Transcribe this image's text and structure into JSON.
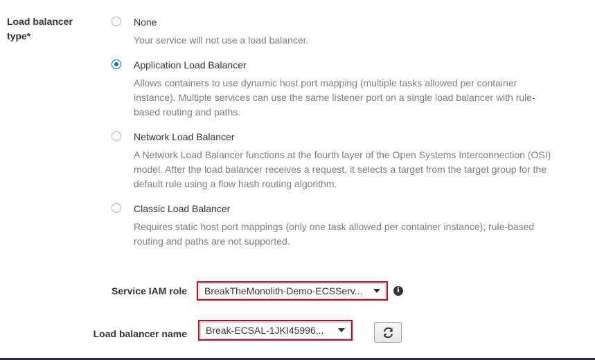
{
  "load_balancer_type": {
    "label": "Load balancer type*",
    "options": [
      {
        "title": "None",
        "description": "Your service will not use a load balancer.",
        "selected": false
      },
      {
        "title": "Application Load Balancer",
        "description": "Allows containers to use dynamic host port mapping (multiple tasks allowed per container instance). Multiple services can use the same listener port on a single load balancer with rule-based routing and paths.",
        "selected": true
      },
      {
        "title": "Network Load Balancer",
        "description": "A Network Load Balancer functions at the fourth layer of the Open Systems Interconnection (OSI) model. After the load balancer receives a request, it selects a target from the target group for the default rule using a flow hash routing algorithm.",
        "selected": false
      },
      {
        "title": "Classic Load Balancer",
        "description": "Requires static host port mappings (only one task allowed per container instance); rule-based routing and paths are not supported.",
        "selected": false
      }
    ]
  },
  "service_iam_role": {
    "label": "Service IAM role",
    "value": "BreakTheMonolith-Demo-ECSServ...",
    "info_icon": "info-icon"
  },
  "load_balancer_name": {
    "label": "Load balancer name",
    "value": "Break-ECSAL-1JKI45996...",
    "refresh_icon": "refresh-icon"
  },
  "colors": {
    "accent": "#0073bb",
    "highlight_border": "#d0021b",
    "description_text": "#7d7d7d",
    "footer_bar": "#232f3e"
  }
}
